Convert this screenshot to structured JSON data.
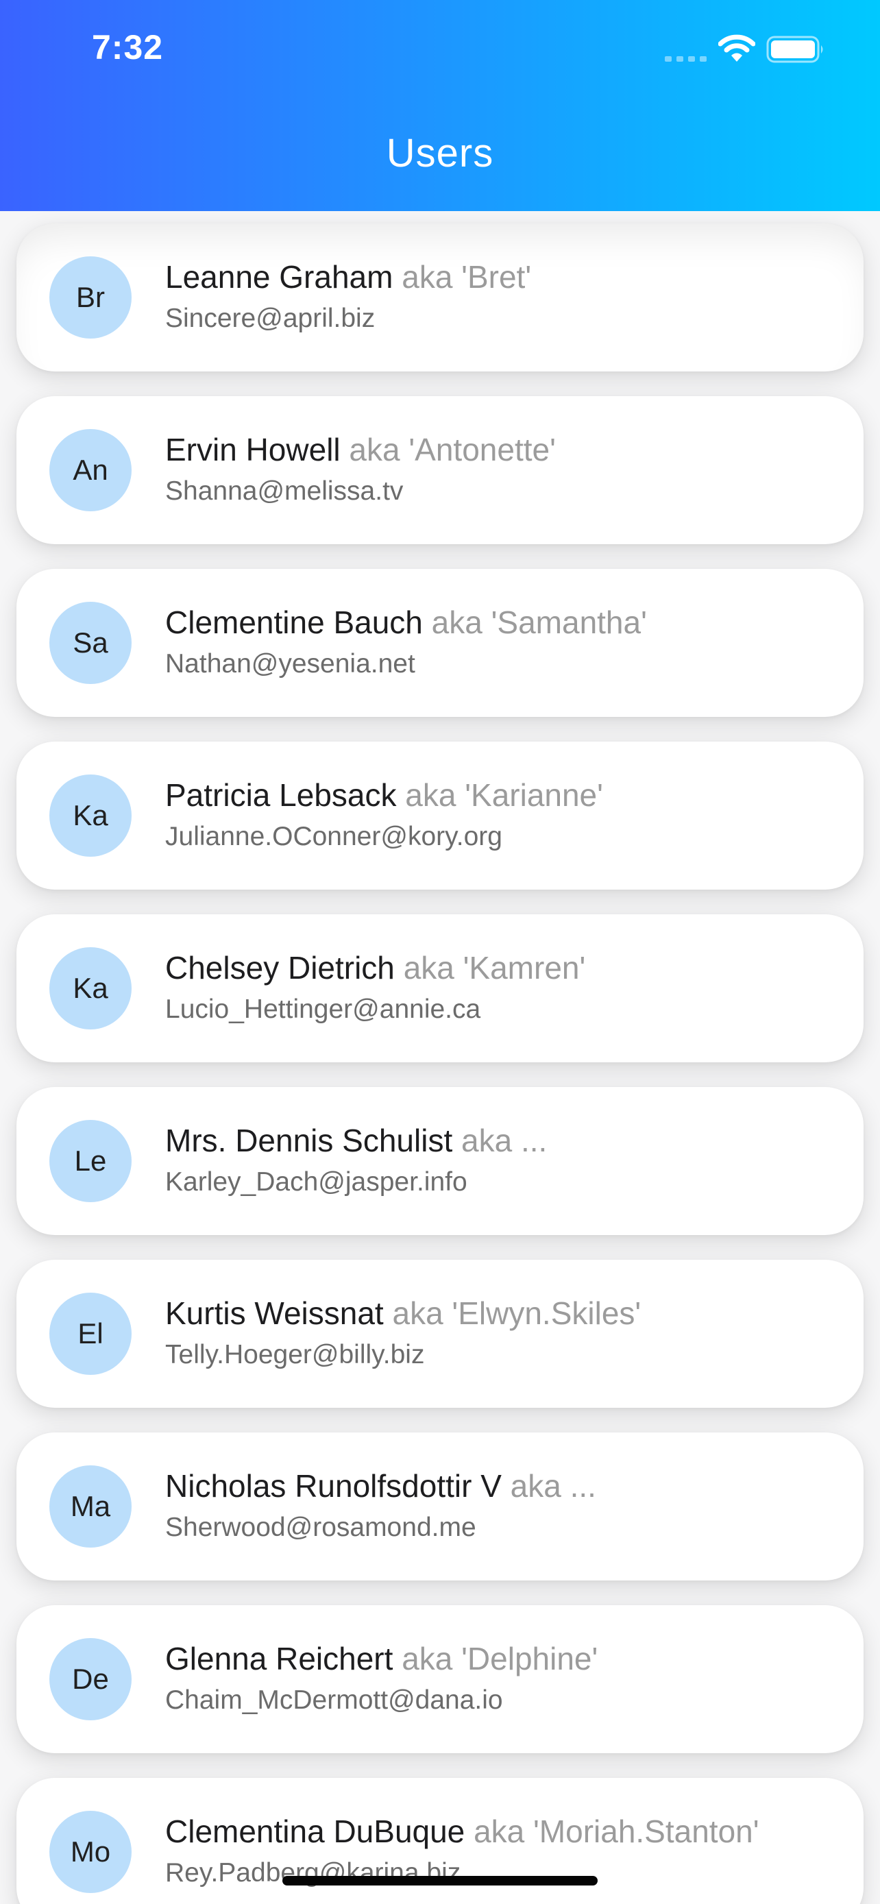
{
  "status_bar": {
    "time": "7:32"
  },
  "header": {
    "title": "Users",
    "gradient_start": "#3a63ff",
    "gradient_end": "#00c9ff"
  },
  "icons": {
    "signal": "cellular-signal-icon",
    "wifi": "wifi-icon",
    "battery": "battery-icon"
  },
  "users": [
    {
      "initials": "Br",
      "name": "Leanne Graham",
      "aka": "aka 'Bret'",
      "email": "Sincere@april.biz"
    },
    {
      "initials": "An",
      "name": "Ervin Howell",
      "aka": "aka 'Antonette'",
      "email": "Shanna@melissa.tv"
    },
    {
      "initials": "Sa",
      "name": "Clementine Bauch",
      "aka": "aka 'Samantha'",
      "email": "Nathan@yesenia.net"
    },
    {
      "initials": "Ka",
      "name": "Patricia Lebsack",
      "aka": "aka 'Karianne'",
      "email": "Julianne.OConner@kory.org"
    },
    {
      "initials": "Ka",
      "name": "Chelsey Dietrich",
      "aka": "aka 'Kamren'",
      "email": "Lucio_Hettinger@annie.ca"
    },
    {
      "initials": "Le",
      "name": "Mrs. Dennis Schulist",
      "aka": "aka ...",
      "email": "Karley_Dach@jasper.info"
    },
    {
      "initials": "El",
      "name": "Kurtis Weissnat",
      "aka": "aka 'Elwyn.Skiles'",
      "email": "Telly.Hoeger@billy.biz"
    },
    {
      "initials": "Ma",
      "name": "Nicholas Runolfsdottir V",
      "aka": "aka ...",
      "email": "Sherwood@rosamond.me"
    },
    {
      "initials": "De",
      "name": "Glenna Reichert",
      "aka": "aka 'Delphine'",
      "email": "Chaim_McDermott@dana.io"
    },
    {
      "initials": "Mo",
      "name": "Clementina DuBuque",
      "aka": "aka 'Moriah.Stanton'",
      "email": "Rey.Padberg@karina.biz"
    }
  ]
}
